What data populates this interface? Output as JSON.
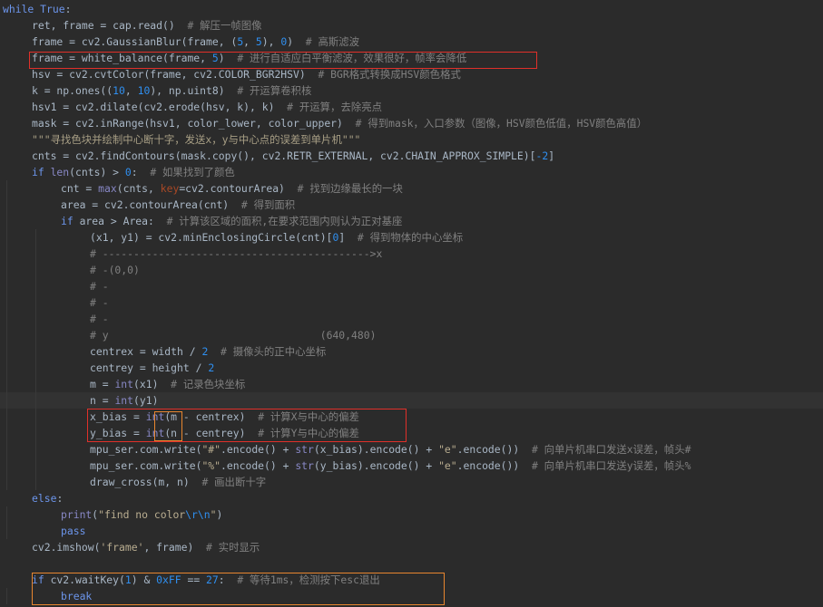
{
  "editor": {
    "theme_colors": {
      "background": "#2b2b2b",
      "text": "#a9b7c6",
      "keyword": "#6c95eb",
      "builtin": "#8888c6",
      "number": "#2f8ff0",
      "comment": "#808080",
      "string": "#b9ad90",
      "highlight_red": "#e0302a",
      "highlight_orange": "#e8862f"
    },
    "current_line": 24,
    "lines": [
      {
        "indent": 0,
        "tokens": [
          {
            "t": "k",
            "v": "while"
          },
          {
            "t": "p",
            "v": " "
          },
          {
            "t": "k",
            "v": "True"
          },
          {
            "t": "p",
            "v": ":"
          }
        ]
      },
      {
        "indent": 1,
        "tokens": [
          {
            "t": "p",
            "v": "ret, frame = cap.read()  "
          },
          {
            "t": "c",
            "v": "# 解压一帧图像"
          }
        ]
      },
      {
        "indent": 1,
        "tokens": [
          {
            "t": "p",
            "v": "frame = cv2.GaussianBlur(frame, ("
          },
          {
            "t": "n",
            "v": "5"
          },
          {
            "t": "p",
            "v": ", "
          },
          {
            "t": "n",
            "v": "5"
          },
          {
            "t": "p",
            "v": "), "
          },
          {
            "t": "n",
            "v": "0"
          },
          {
            "t": "p",
            "v": ")  "
          },
          {
            "t": "c",
            "v": "# 高斯滤波"
          }
        ]
      },
      {
        "indent": 1,
        "tokens": [
          {
            "t": "p",
            "v": "frame = white_balance(frame, "
          },
          {
            "t": "n",
            "v": "5"
          },
          {
            "t": "p",
            "v": ")  "
          },
          {
            "t": "c",
            "v": "# 进行自适应白平衡滤波，效果很好，帧率会降低"
          }
        ]
      },
      {
        "indent": 1,
        "tokens": [
          {
            "t": "p",
            "v": "hsv = cv2.cvtColor(frame, cv2.COLOR_BGR2HSV)  "
          },
          {
            "t": "c",
            "v": "# BGR格式转换成HSV颜色格式"
          }
        ]
      },
      {
        "indent": 1,
        "tokens": [
          {
            "t": "p",
            "v": "k = np.ones(("
          },
          {
            "t": "n",
            "v": "10"
          },
          {
            "t": "p",
            "v": ", "
          },
          {
            "t": "n",
            "v": "10"
          },
          {
            "t": "p",
            "v": "), np.uint8)  "
          },
          {
            "t": "c",
            "v": "# 开运算卷积核"
          }
        ]
      },
      {
        "indent": 1,
        "tokens": [
          {
            "t": "p",
            "v": "hsv1 = cv2.dilate(cv2.erode(hsv, k), k)  "
          },
          {
            "t": "c",
            "v": "# 开运算，去除亮点"
          }
        ]
      },
      {
        "indent": 1,
        "tokens": [
          {
            "t": "p",
            "v": "mask = cv2.inRange(hsv1, color_lower, color_upper)  "
          },
          {
            "t": "c",
            "v": "# 得到mask，入口参数（图像，HSV颜色低值，HSV颜色高值）"
          }
        ]
      },
      {
        "indent": 1,
        "tokens": [
          {
            "t": "d",
            "v": "\"\"\"寻找色块并绘制中心断十字，发送x，y与中心点的误差到单片机\"\"\""
          }
        ]
      },
      {
        "indent": 1,
        "tokens": [
          {
            "t": "p",
            "v": "cnts = cv2.findContours(mask.copy(), cv2.RETR_EXTERNAL, cv2.CHAIN_APPROX_SIMPLE)["
          },
          {
            "t": "n",
            "v": "-2"
          },
          {
            "t": "p",
            "v": "]"
          }
        ]
      },
      {
        "indent": 1,
        "tokens": [
          {
            "t": "k",
            "v": "if "
          },
          {
            "t": "b",
            "v": "len"
          },
          {
            "t": "p",
            "v": "(cnts) > "
          },
          {
            "t": "n",
            "v": "0"
          },
          {
            "t": "p",
            "v": ":  "
          },
          {
            "t": "c",
            "v": "# 如果找到了颜色"
          }
        ]
      },
      {
        "indent": 2,
        "tokens": [
          {
            "t": "p",
            "v": "cnt = "
          },
          {
            "t": "b",
            "v": "max"
          },
          {
            "t": "p",
            "v": "(cnts, "
          },
          {
            "t": "kw",
            "v": "key"
          },
          {
            "t": "p",
            "v": "=cv2.contourArea)  "
          },
          {
            "t": "c",
            "v": "# 找到边缘最长的一块"
          }
        ]
      },
      {
        "indent": 2,
        "tokens": [
          {
            "t": "p",
            "v": "area = cv2.contourArea(cnt)  "
          },
          {
            "t": "c",
            "v": "# 得到面积"
          }
        ]
      },
      {
        "indent": 2,
        "tokens": [
          {
            "t": "k",
            "v": "if"
          },
          {
            "t": "p",
            "v": " area > Area:  "
          },
          {
            "t": "c",
            "v": "# 计算该区域的面积,在要求范围内则认为正对基座"
          }
        ]
      },
      {
        "indent": 3,
        "tokens": [
          {
            "t": "p",
            "v": "(x1, y1) = cv2.minEnclosingCircle(cnt)["
          },
          {
            "t": "n",
            "v": "0"
          },
          {
            "t": "p",
            "v": "]  "
          },
          {
            "t": "c",
            "v": "# 得到物体的中心坐标"
          }
        ]
      },
      {
        "indent": 3,
        "tokens": [
          {
            "t": "c",
            "v": "# ------------------------------------------->x"
          }
        ]
      },
      {
        "indent": 3,
        "tokens": [
          {
            "t": "c",
            "v": "# -(0,0)"
          }
        ]
      },
      {
        "indent": 3,
        "tokens": [
          {
            "t": "c",
            "v": "# -"
          }
        ]
      },
      {
        "indent": 3,
        "tokens": [
          {
            "t": "c",
            "v": "# -"
          }
        ]
      },
      {
        "indent": 3,
        "tokens": [
          {
            "t": "c",
            "v": "# -"
          }
        ]
      },
      {
        "indent": 3,
        "tokens": [
          {
            "t": "c",
            "v": "# y                                  (640,480)"
          }
        ]
      },
      {
        "indent": 3,
        "tokens": [
          {
            "t": "p",
            "v": "centrex = width / "
          },
          {
            "t": "n",
            "v": "2"
          },
          {
            "t": "p",
            "v": "  "
          },
          {
            "t": "c",
            "v": "# 摄像头的正中心坐标"
          }
        ]
      },
      {
        "indent": 3,
        "tokens": [
          {
            "t": "p",
            "v": "centrey = height / "
          },
          {
            "t": "n",
            "v": "2"
          }
        ]
      },
      {
        "indent": 3,
        "tokens": [
          {
            "t": "p",
            "v": "m = "
          },
          {
            "t": "b",
            "v": "int"
          },
          {
            "t": "p",
            "v": "(x1)  "
          },
          {
            "t": "c",
            "v": "# 记录色块坐标"
          }
        ]
      },
      {
        "indent": 3,
        "tokens": [
          {
            "t": "p",
            "v": "n = "
          },
          {
            "t": "b",
            "v": "int"
          },
          {
            "t": "p",
            "v": "(y1)"
          }
        ]
      },
      {
        "indent": 3,
        "tokens": [
          {
            "t": "p",
            "v": "x_bias = "
          },
          {
            "t": "b",
            "v": "int"
          },
          {
            "t": "p",
            "v": "(m - centrex)  "
          },
          {
            "t": "c",
            "v": "# 计算X与中心的偏差"
          }
        ]
      },
      {
        "indent": 3,
        "tokens": [
          {
            "t": "p",
            "v": "y_bias = "
          },
          {
            "t": "b",
            "v": "int"
          },
          {
            "t": "p",
            "v": "(n - centrey)  "
          },
          {
            "t": "c",
            "v": "# 计算Y与中心的偏差"
          }
        ]
      },
      {
        "indent": 3,
        "tokens": [
          {
            "t": "p",
            "v": "mpu_ser.com.write("
          },
          {
            "t": "s",
            "v": "\"#\""
          },
          {
            "t": "p",
            "v": ".encode() + "
          },
          {
            "t": "b",
            "v": "str"
          },
          {
            "t": "p",
            "v": "(x_bias).encode() + "
          },
          {
            "t": "s",
            "v": "\"e\""
          },
          {
            "t": "p",
            "v": ".encode())  "
          },
          {
            "t": "c",
            "v": "# 向单片机串口发送x误差，帧头#"
          }
        ]
      },
      {
        "indent": 3,
        "tokens": [
          {
            "t": "p",
            "v": "mpu_ser.com.write("
          },
          {
            "t": "s",
            "v": "\"%\""
          },
          {
            "t": "p",
            "v": ".encode() + "
          },
          {
            "t": "b",
            "v": "str"
          },
          {
            "t": "p",
            "v": "(y_bias).encode() + "
          },
          {
            "t": "s",
            "v": "\"e\""
          },
          {
            "t": "p",
            "v": ".encode())  "
          },
          {
            "t": "c",
            "v": "# 向单片机串口发送y误差，帧头%"
          }
        ]
      },
      {
        "indent": 3,
        "tokens": [
          {
            "t": "p",
            "v": "draw_cross(m, n)  "
          },
          {
            "t": "c",
            "v": "# 画出断十字"
          }
        ]
      },
      {
        "indent": 1,
        "tokens": [
          {
            "t": "k",
            "v": "else"
          },
          {
            "t": "p",
            "v": ":"
          }
        ]
      },
      {
        "indent": 2,
        "tokens": [
          {
            "t": "b",
            "v": "print"
          },
          {
            "t": "p",
            "v": "("
          },
          {
            "t": "s",
            "v": "\"find no color"
          },
          {
            "t": "e",
            "v": "\\r\\n"
          },
          {
            "t": "s",
            "v": "\""
          },
          {
            "t": "p",
            "v": ")"
          }
        ]
      },
      {
        "indent": 2,
        "tokens": [
          {
            "t": "k",
            "v": "pass"
          }
        ]
      },
      {
        "indent": 1,
        "tokens": [
          {
            "t": "p",
            "v": "cv2.imshow("
          },
          {
            "t": "s",
            "v": "'frame'"
          },
          {
            "t": "p",
            "v": ", frame)  "
          },
          {
            "t": "c",
            "v": "# 实时显示"
          }
        ]
      },
      {
        "indent": 1,
        "tokens": []
      },
      {
        "indent": 1,
        "tokens": [
          {
            "t": "k",
            "v": "if"
          },
          {
            "t": "p",
            "v": " cv2.waitKey("
          },
          {
            "t": "n",
            "v": "1"
          },
          {
            "t": "p",
            "v": ") & "
          },
          {
            "t": "n",
            "v": "0xFF"
          },
          {
            "t": "p",
            "v": " == "
          },
          {
            "t": "n",
            "v": "27"
          },
          {
            "t": "p",
            "v": ":  "
          },
          {
            "t": "c",
            "v": "# 等待1ms，检测按下esc退出"
          }
        ]
      },
      {
        "indent": 2,
        "tokens": [
          {
            "t": "k",
            "v": "break"
          }
        ]
      }
    ]
  }
}
